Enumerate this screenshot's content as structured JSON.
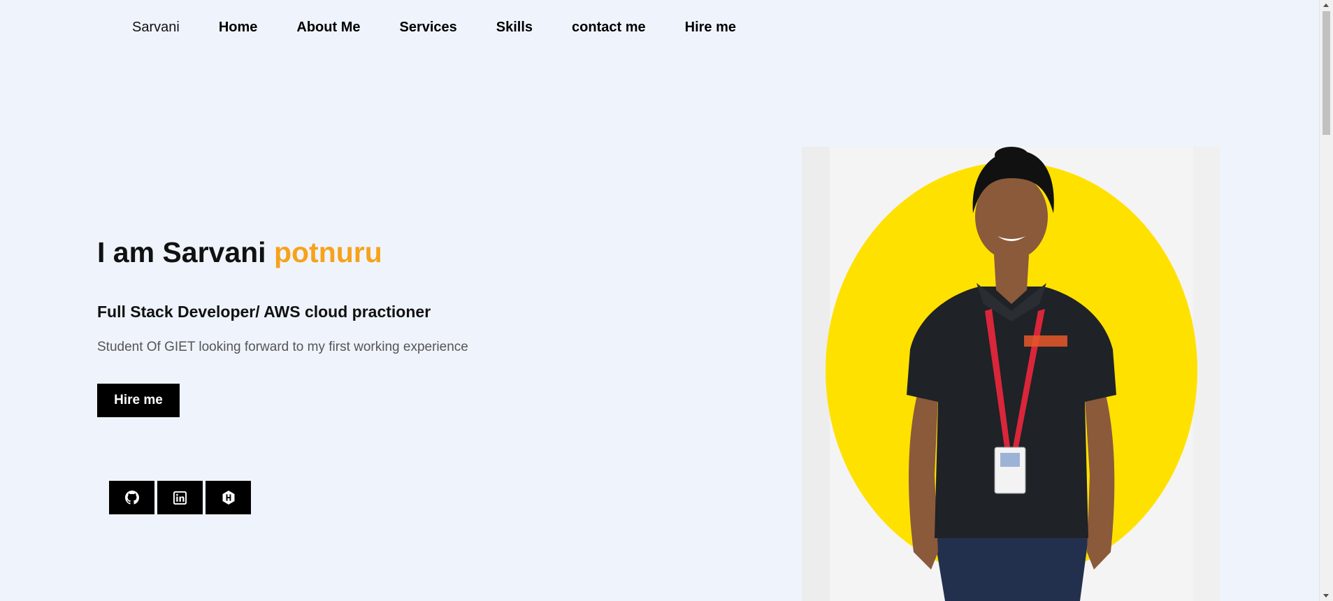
{
  "nav": {
    "brand": "Sarvani",
    "links": [
      "Home",
      "About Me",
      "Services",
      "Skills",
      "contact me",
      "Hire me"
    ]
  },
  "hero": {
    "title_prefix": "I am Sarvani ",
    "title_accent": "potnuru",
    "subtitle": "Full Stack Developer/ AWS cloud practioner",
    "description": "Student Of GIET looking forward to my first working experience",
    "button": "Hire me"
  },
  "socials": [
    {
      "icon": "github-icon"
    },
    {
      "icon": "linkedin-icon"
    },
    {
      "icon": "hackerrank-icon"
    }
  ],
  "colors": {
    "background": "#eff4fc",
    "accent": "#f7a21b",
    "button": "#000000",
    "photo_circle": "#ffe100"
  }
}
